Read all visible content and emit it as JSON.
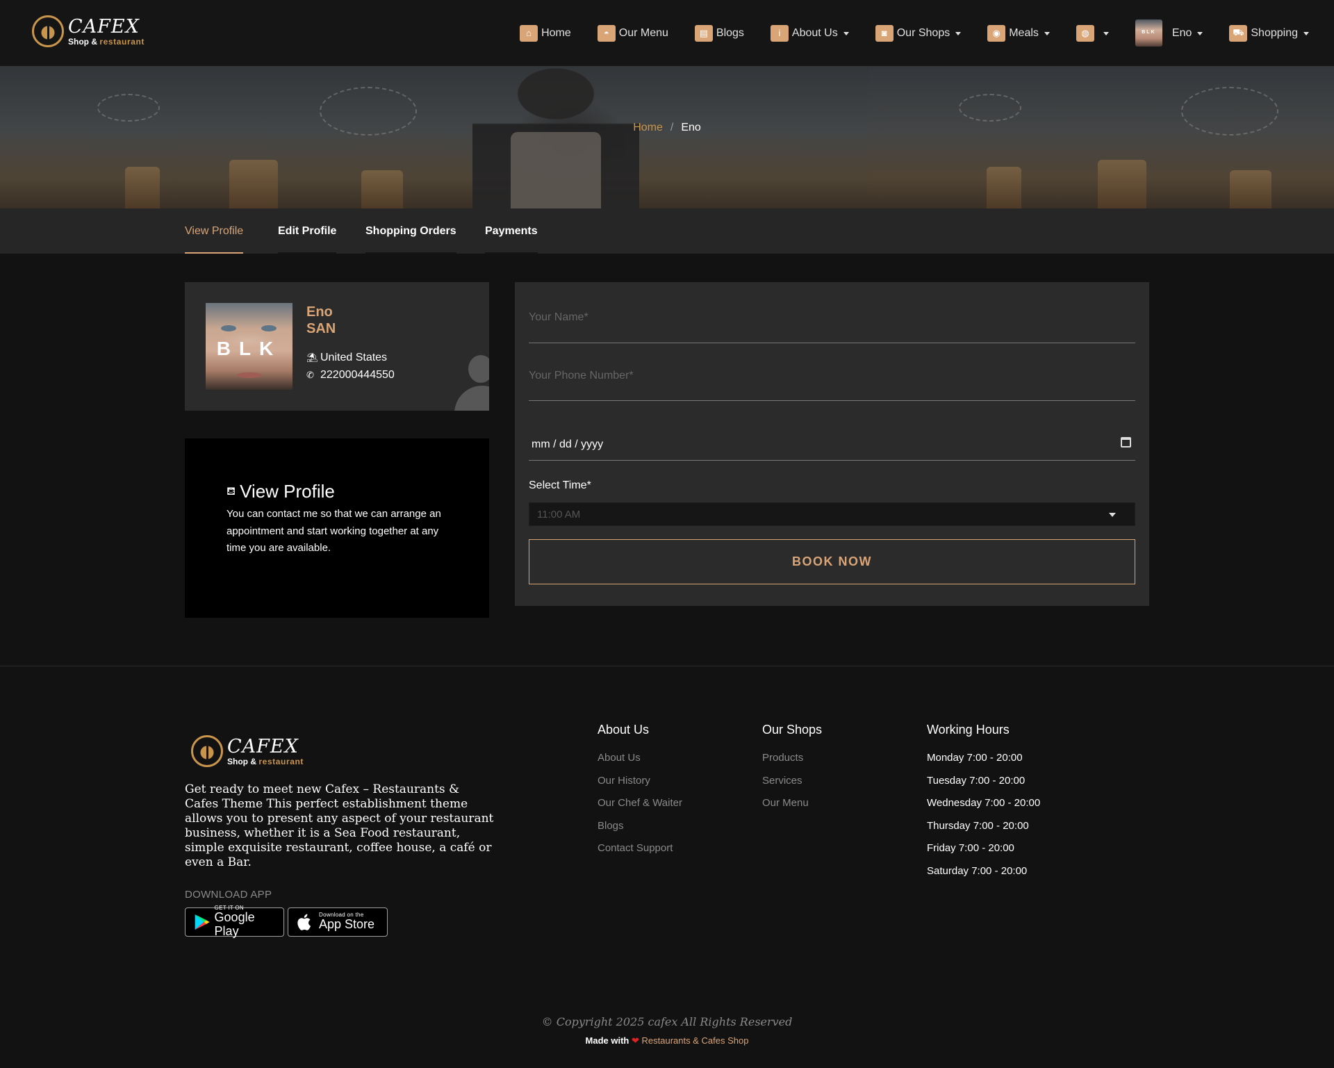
{
  "brand": {
    "name": "CAFEX",
    "sub_a": "Shop &",
    "sub_b": "restaurant",
    "accent": "#d9a577"
  },
  "nav": {
    "items": [
      {
        "label": "Home",
        "icon": "home-icon",
        "glyph": "⌂"
      },
      {
        "label": "Our Menu",
        "icon": "cloche-icon",
        "glyph": "◓"
      },
      {
        "label": "Blogs",
        "icon": "newspaper-icon",
        "glyph": "▤"
      },
      {
        "label": "About Us",
        "icon": "info-icon",
        "glyph": "i"
      },
      {
        "label": "Our Shops",
        "icon": "shop-bag-icon",
        "glyph": "◙"
      },
      {
        "label": "Meals",
        "icon": "meal-icon",
        "glyph": "◉"
      }
    ],
    "language_icon": "globe-icon",
    "user_label": "Eno",
    "shopping_label": "Shopping",
    "shopping_icon": "cart-icon"
  },
  "breadcrumb": {
    "home": "Home",
    "separator": "/",
    "current": "Eno"
  },
  "tabs": [
    {
      "label": "View Profile",
      "active": true
    },
    {
      "label": "Edit Profile",
      "active": false
    },
    {
      "label": "Shopping Orders",
      "active": false
    },
    {
      "label": "Payments",
      "active": false
    }
  ],
  "profile": {
    "first_name": "Eno",
    "last_name": "SAN",
    "country": "United States",
    "phone": "222000444550",
    "photo_text": "BLK"
  },
  "info_card": {
    "title": "View Profile",
    "text": "You can contact me so that we can arrange an appointment and start working together at any time you are available."
  },
  "booking": {
    "name_placeholder": "Your Name*",
    "phone_placeholder": "Your Phone Number*",
    "date_value": "mm / dd / yyyy",
    "time_label": "Select Time*",
    "time_value": "11:00 AM",
    "button": "BOOK NOW"
  },
  "footer": {
    "description": "Get ready to meet new Cafex – Restaurants & Cafes Theme This perfect establishment theme allows you to present any aspect of your restaurant business, whether it is a Sea Food restaurant, simple exquisite restaurant, coffee house, a café or even a Bar.",
    "download_label": "DOWNLOAD APP",
    "google_small": "GET IT ON",
    "google_big": "Google Play",
    "apple_small": "Download on the",
    "apple_big": "App Store",
    "about": {
      "title": "About Us",
      "links": [
        "About Us",
        "Our History",
        "Our Chef & Waiter",
        "Blogs",
        "Contact Support"
      ]
    },
    "shops": {
      "title": "Our Shops",
      "links": [
        "Products",
        "Services",
        "Our Menu"
      ]
    },
    "hours": {
      "title": "Working Hours",
      "rows": [
        "Monday 7:00 - 20:00",
        "Tuesday 7:00 - 20:00",
        "Wednesday 7:00 - 20:00",
        "Thursday 7:00 - 20:00",
        "Friday 7:00 - 20:00",
        "Saturday 7:00 - 20:00"
      ]
    },
    "copyright": "© Copyright 2025 cafex All Rights Reserved",
    "made_with": "Made with",
    "made_brand": "Restaurants & Cafes Shop"
  }
}
